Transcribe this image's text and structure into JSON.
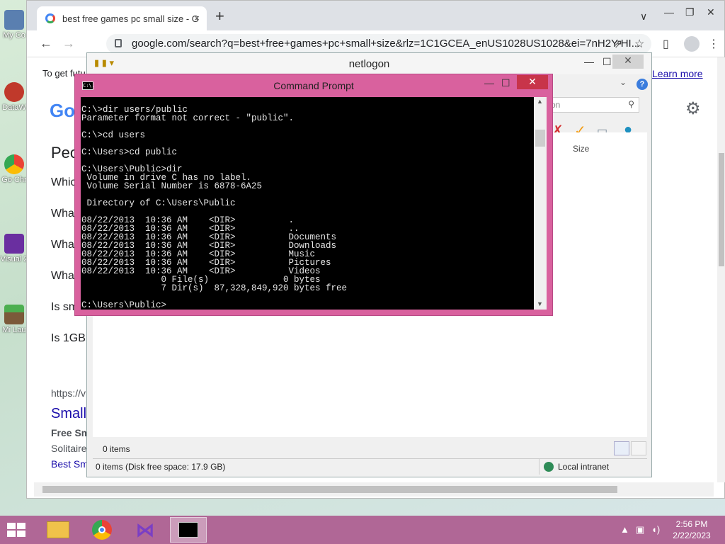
{
  "desktop": {
    "icons": [
      "My Co",
      "DataW",
      "Go Chr",
      "Visual 2",
      "Mi Lau"
    ]
  },
  "chrome": {
    "tab_title": "best free games pc small size - G",
    "tab_close": "×",
    "new_tab": "+",
    "url": "google.com/search?q=best+free+games+pc+small+size&rlz=1C1GCEA_enUS1028US1028&ei=7nH2Y-HI...",
    "window_controls": [
      "∨",
      "—",
      "❐",
      "✕"
    ],
    "back": "←",
    "forward": "→",
    "refresh": "C"
  },
  "google": {
    "logo": "Go",
    "get_future": "To get futu",
    "learn_more": "Learn more",
    "paa_title": "Peo",
    "paa_items": [
      "Whic",
      "What",
      "What",
      "What",
      "Is sm",
      "Is 1GB"
    ],
    "result_url": "https://v",
    "result_title": "Small",
    "result_snippets": [
      "Free Sm",
      "Solitaire",
      "Best Sm"
    ]
  },
  "explorer": {
    "title": "netlogon",
    "search_placeholder": "on",
    "column_size": "Size",
    "items_count": "0 items",
    "status_left": "0 items (Disk free space: 17.9 GB)",
    "status_zone": "Local intranet",
    "minimize": "—",
    "maximize": "☐",
    "close": "✕"
  },
  "cmd": {
    "title": "Command Prompt",
    "icon_text": "C:\\.",
    "minimize": "—",
    "maximize": "☐",
    "close": "✕",
    "lines": [
      "C:\\>dir users/public",
      "Parameter format not correct - \"public\".",
      "",
      "C:\\>cd users",
      "",
      "C:\\Users>cd public",
      "",
      "C:\\Users\\Public>dir",
      " Volume in drive C has no label.",
      " Volume Serial Number is 6878-6A25",
      "",
      " Directory of C:\\Users\\Public",
      "",
      "08/22/2013  10:36 AM    <DIR>          .",
      "08/22/2013  10:36 AM    <DIR>          ..",
      "08/22/2013  10:36 AM    <DIR>          Documents",
      "08/22/2013  10:36 AM    <DIR>          Downloads",
      "08/22/2013  10:36 AM    <DIR>          Music",
      "08/22/2013  10:36 AM    <DIR>          Pictures",
      "08/22/2013  10:36 AM    <DIR>          Videos",
      "               0 File(s)              0 bytes",
      "               7 Dir(s)  87,328,849,920 bytes free",
      "",
      "C:\\Users\\Public>"
    ]
  },
  "taskbar": {
    "time": "2:56 PM",
    "date": "2/22/2023",
    "apps": [
      "file-explorer",
      "chrome",
      "visual-studio",
      "command-prompt"
    ]
  }
}
